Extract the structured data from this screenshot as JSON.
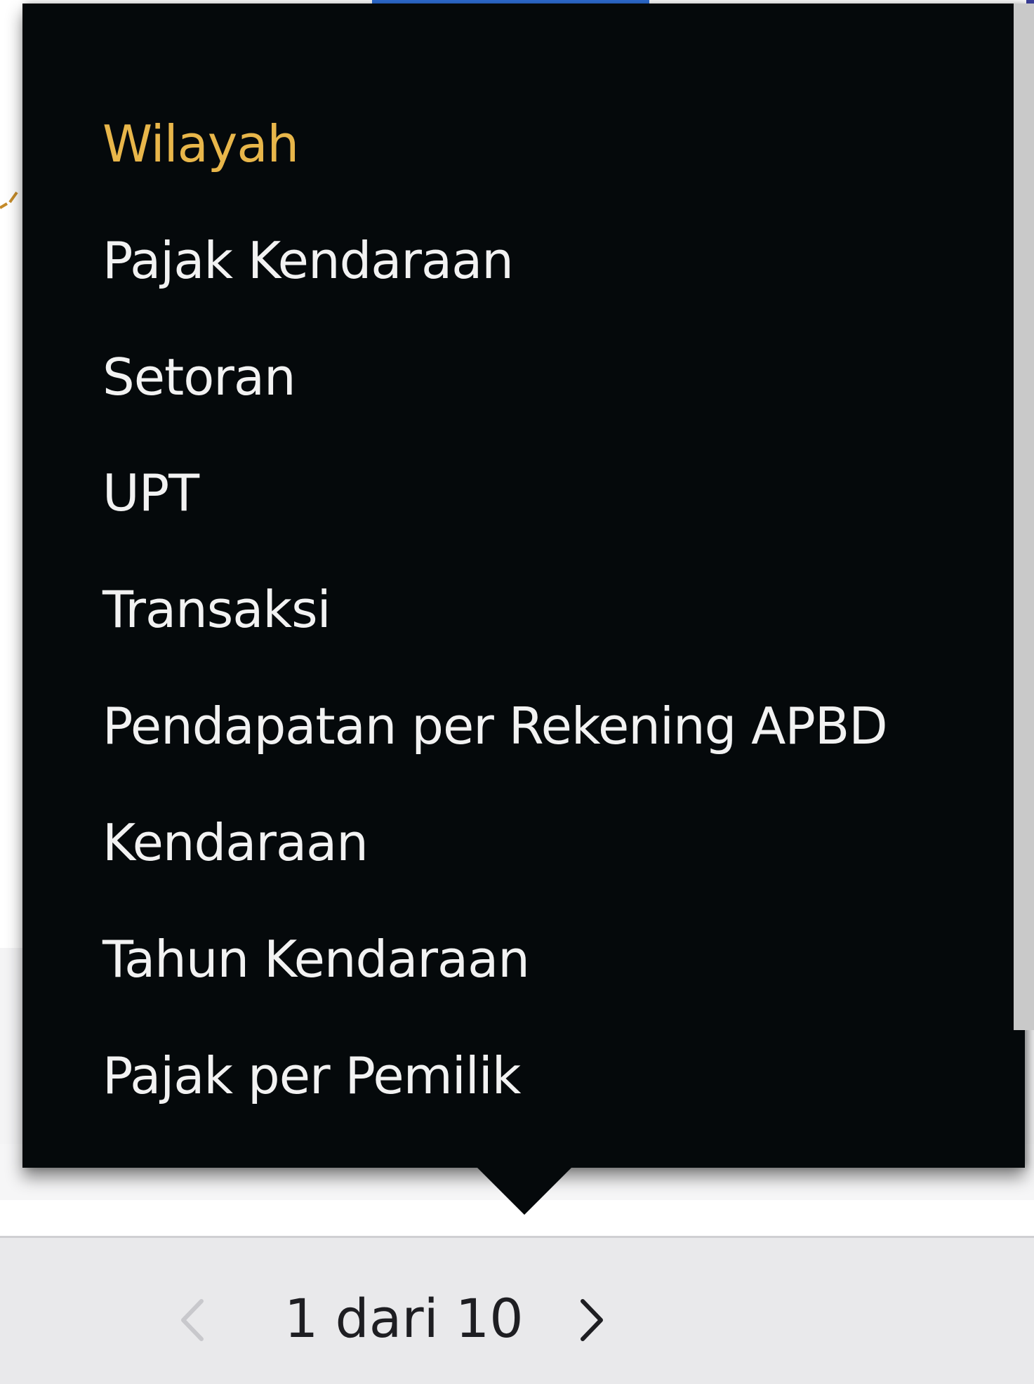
{
  "menu": {
    "items": [
      {
        "label": "Wilayah",
        "selected": true
      },
      {
        "label": "Pajak Kendaraan",
        "selected": false
      },
      {
        "label": "Setoran",
        "selected": false
      },
      {
        "label": "UPT",
        "selected": false
      },
      {
        "label": "Transaksi",
        "selected": false
      },
      {
        "label": "Pendapatan per Rekening APBD",
        "selected": false
      },
      {
        "label": "Kendaraan",
        "selected": false
      },
      {
        "label": "Tahun Kendaraan",
        "selected": false
      },
      {
        "label": "Pajak per Pemilik",
        "selected": false
      }
    ],
    "selected_color": "#e8b64a",
    "text_color": "#f2f2f2",
    "background_color": "#05090b"
  },
  "pager": {
    "text": "1 dari 10",
    "prev_icon": "chevron-left-icon",
    "next_icon": "chevron-right-icon",
    "prev_enabled": false,
    "next_enabled": true
  }
}
